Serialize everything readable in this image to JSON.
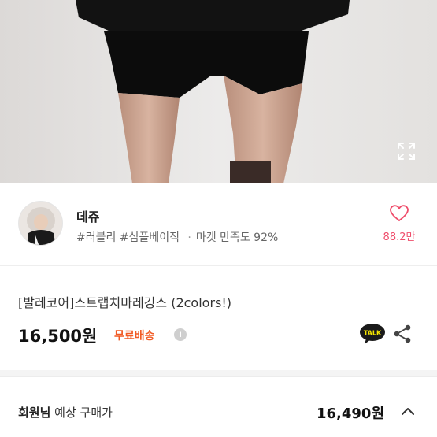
{
  "product_image": {
    "alt": "product photo",
    "expand_icon": "expand-icon"
  },
  "seller": {
    "name": "데쥬",
    "tags": [
      "#러블리",
      "#심플베이직"
    ],
    "separator": "·",
    "satisfaction": "마켓 만족도 92%",
    "like_count": "88.2만",
    "like_icon": "heart-outline-icon",
    "accent_color": "#ef4d6b"
  },
  "product": {
    "title": "[발레코어]스트랩치마레깅스 (2colors!)",
    "price": "16,500원",
    "shipping": "무료배송",
    "shipping_color": "#f15a24",
    "info_glyph": "i",
    "talk_label": "TALK",
    "share_icon": "share-icon"
  },
  "member_price": {
    "label_strong": "회원님",
    "label_rest": " 예상 구매가",
    "price": "16,490원",
    "toggle_icon": "chevron-up-icon"
  }
}
